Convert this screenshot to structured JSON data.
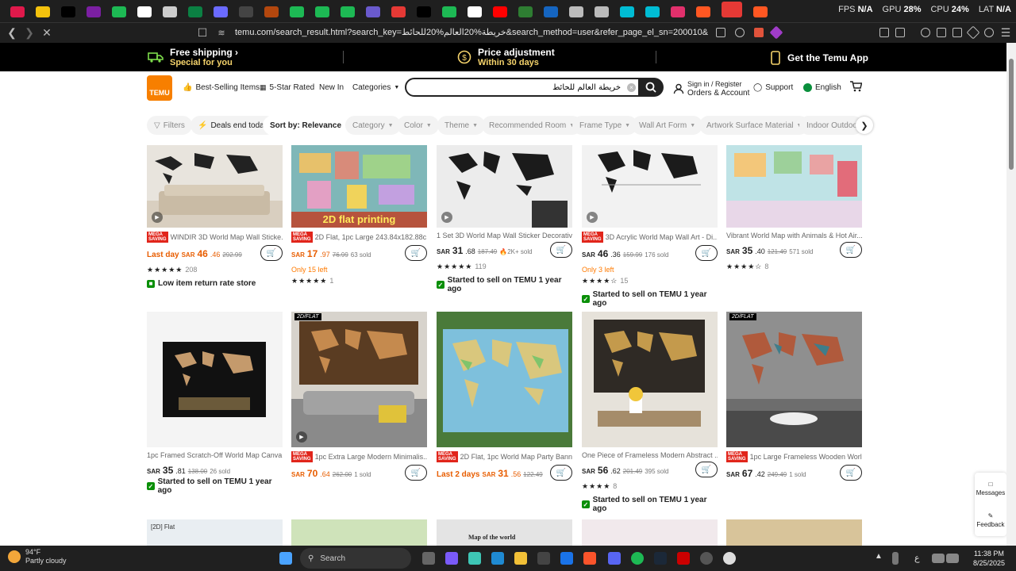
{
  "browser": {
    "url": "temu.com/search_result.html?search_key=خريطة%20العالم%20للحائط&search_method=user&refer_page_el_sn=200010&srch_enter_source=top...",
    "stats": {
      "fps_label": "FPS",
      "fps_value": "N/A",
      "gpu_label": "GPU",
      "gpu_value": "28%",
      "cpu_label": "CPU",
      "cpu_value": "24%",
      "lat_label": "LAT",
      "lat_value": "N/A"
    },
    "tab_colors": [
      "#e0194b",
      "#f4c20d",
      "#000000",
      "#7b1fa2",
      "#1db954",
      "#ffffff",
      "#cccccc",
      "#0b8043",
      "#6b6bff",
      "#444444",
      "#b3470e",
      "#1db954",
      "#1db954",
      "#1db954",
      "#6a5acd",
      "#e53935",
      "#000000",
      "#1db954",
      "#ffffff",
      "#ff0000",
      "#2e7d32",
      "#1565c0",
      "#bbbbbb",
      "#bbbbbb",
      "#00bcd4",
      "#00bcd4",
      "#e1306c",
      "#ff5722",
      "#e53935",
      "#ff5722"
    ]
  },
  "banner": {
    "shipping_title": "Free shipping",
    "shipping_sub": "Special for you",
    "price_title": "Price adjustment",
    "price_sub": "Within 30 days",
    "app_title": "Get the Temu App"
  },
  "header": {
    "logo_text": "TEMU",
    "nav": {
      "best": "Best-Selling Items",
      "rated": "5-Star Rated",
      "new": "New In",
      "categories": "Categories"
    },
    "search_value": "خريطة العالم للحائط",
    "signin_top": "Sign in / Register",
    "signin_bottom": "Orders & Account",
    "support": "Support",
    "language": "English"
  },
  "filters": {
    "filters": "Filters",
    "deals": "Deals end today",
    "sort": "Sort by: Relevance",
    "category": "Category",
    "color": "Color",
    "theme": "Theme",
    "room": "Recommended Room",
    "frame": "Frame Type",
    "wallart": "Wall Art Form",
    "material": "Artwork Surface Material",
    "indoor": "Indoor Outdoor"
  },
  "products": [
    {
      "title": "WINDIR 3D World Map Wall Sticke...",
      "mega": true,
      "badge_word1": "MEGA",
      "badge_word2": "SAVING",
      "price_prefix": "Last day",
      "currency": "SAR",
      "price_int": "46",
      "price_dec": ".46",
      "old": "292.99",
      "sold": "",
      "stars": "★★★★★",
      "reviews": "208",
      "extra": "Low item return rate store"
    },
    {
      "title": "2D Flat, 1pc Large 243.84x182.88c...",
      "mega": true,
      "badge_word1": "MEGA",
      "badge_word2": "SAVING",
      "overlay": "2D flat printing",
      "currency": "SAR",
      "price_int": "17",
      "price_dec": ".97",
      "old": "76.99",
      "sold": "63 sold",
      "left": "Only 15 left",
      "stars": "★★★★★",
      "reviews": "1"
    },
    {
      "title": "1 Set 3D World Map Wall Sticker Decorativ...",
      "mega": false,
      "currency": "SAR",
      "price_int": "31",
      "price_dec": ".68",
      "old": "187.49",
      "sold": "2K+ sold",
      "stars": "★★★★★",
      "reviews": "119",
      "extra": "Started to sell on TEMU 1 year ago"
    },
    {
      "title": "3D Acrylic World Map Wall Art - Di...",
      "mega": true,
      "badge_word1": "MEGA",
      "badge_word2": "SAVING",
      "currency": "SAR",
      "price_int": "46",
      "price_dec": ".36",
      "old": "159.99",
      "sold": "176 sold",
      "left": "Only 3 left",
      "stars": "★★★★☆",
      "reviews": "15",
      "extra": "Started to sell on TEMU 1 year ago"
    },
    {
      "title": "Vibrant World Map with Animals & Hot Air...",
      "mega": false,
      "currency": "SAR",
      "price_int": "35",
      "price_dec": ".40",
      "old": "121.49",
      "sold": "571 sold",
      "stars": "★★★★☆",
      "reviews": "8"
    },
    {
      "title": "1pc Framed Scratch-Off World Map Canva...",
      "mega": false,
      "currency": "SAR",
      "price_int": "35",
      "price_dec": ".81",
      "old": "138.00",
      "sold": "26 sold",
      "extra": "Started to sell on TEMU 1 year ago"
    },
    {
      "title": "1pc Extra Large Modern Minimalis...",
      "mega": true,
      "badge_word1": "MEGA",
      "badge_word2": "SAVING",
      "tag2d": "2D/FLAT",
      "currency": "SAR",
      "price_int": "70",
      "price_dec": ".64",
      "old": "262.00",
      "sold": "1 sold"
    },
    {
      "title": "2D Flat, 1pc World Map Party Bann...",
      "mega": true,
      "badge_word1": "MEGA",
      "badge_word2": "SAVING",
      "price_prefix": "Last 2 days",
      "currency": "SAR",
      "price_int": "31",
      "price_dec": ".56",
      "old": "122.49",
      "sold": ""
    },
    {
      "title": "One Piece of Frameless Modern Abstract ...",
      "mega": false,
      "currency": "SAR",
      "price_int": "56",
      "price_dec": ".62",
      "old": "201.49",
      "sold": "395 sold",
      "stars": "★★★★",
      "reviews": "8",
      "extra": "Started to sell on TEMU 1 year ago"
    },
    {
      "title": "1pc Large Frameless Wooden Worl...",
      "mega": true,
      "badge_word1": "MEGA",
      "badge_word2": "SAVING",
      "tag2d": "2D/FLAT",
      "currency": "SAR",
      "price_int": "67",
      "price_dec": ".42",
      "old": "249.49",
      "sold": "1 sold"
    }
  ],
  "row3_tags": {
    "first": "[2D] Flat",
    "third": "Map of the world"
  },
  "sidebar": {
    "messages": "Messages",
    "feedback": "Feedback"
  },
  "taskbar": {
    "temp": "94°F",
    "weather": "Partly cloudy",
    "search": "Search",
    "lang": "ع",
    "time": "11:38 PM",
    "date": "8/25/2025"
  }
}
